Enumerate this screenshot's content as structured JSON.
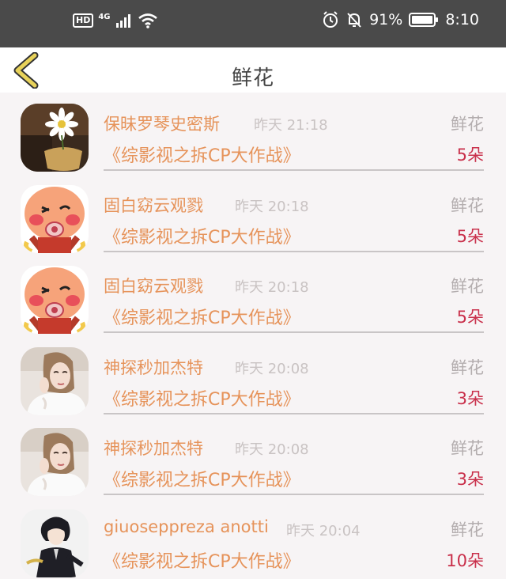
{
  "status_bar": {
    "hd": "HD",
    "network": "4G",
    "battery": "91%",
    "time": "8:10",
    "icons": [
      "hd-icon",
      "signal-icon",
      "wifi-icon",
      "alarm-icon",
      "bell-off-icon",
      "battery-icon"
    ]
  },
  "header": {
    "title": "鲜花",
    "back_icon": "chevron-left-icon"
  },
  "colors": {
    "accent": "#e6935a",
    "count": "#c9304b",
    "back": "#e8d25a"
  },
  "rows": [
    {
      "name": "保昧罗琴史密斯",
      "time": "昨天 21:18",
      "label": "鲜花",
      "work": "《综影视之拆CP大作战》",
      "count": "5朵",
      "avatar": "flower-photo"
    },
    {
      "name": "固白窈云观戮",
      "time": "昨天 20:18",
      "label": "鲜花",
      "work": "《综影视之拆CP大作战》",
      "count": "5朵",
      "avatar": "cartoon-baby"
    },
    {
      "name": "固白窈云观戮",
      "time": "昨天 20:18",
      "label": "鲜花",
      "work": "《综影视之拆CP大作战》",
      "count": "5朵",
      "avatar": "cartoon-baby"
    },
    {
      "name": "神探秒加杰特",
      "time": "昨天 20:08",
      "label": "鲜花",
      "work": "《综影视之拆CP大作战》",
      "count": "3朵",
      "avatar": "woman-photo"
    },
    {
      "name": "神探秒加杰特",
      "time": "昨天 20:08",
      "label": "鲜花",
      "work": "《综影视之拆CP大作战》",
      "count": "3朵",
      "avatar": "woman-photo"
    },
    {
      "name": "giuoseppreza anotti",
      "time": "昨天 20:04",
      "label": "鲜花",
      "work": "《综影视之拆CP大作战》",
      "count": "10朵",
      "avatar": "anime-man"
    }
  ]
}
